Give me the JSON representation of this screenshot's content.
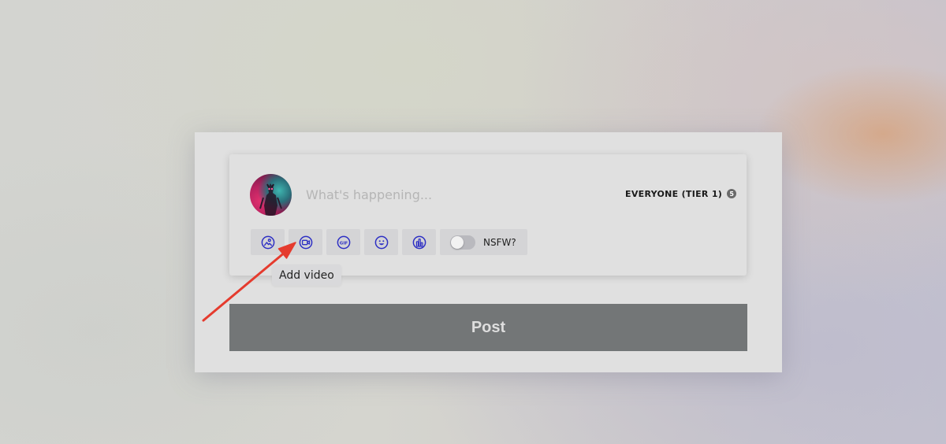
{
  "composer": {
    "placeholder": "What's happening...",
    "audience_label": "EVERYONE (TIER 1)",
    "audience_badge": "5"
  },
  "toolbar": {
    "tools": [
      {
        "name": "add-image",
        "icon": "image-icon"
      },
      {
        "name": "add-video",
        "icon": "video-icon"
      },
      {
        "name": "add-gif",
        "icon": "gif-icon",
        "icon_text": "GIF"
      },
      {
        "name": "add-emoji",
        "icon": "emoji-icon"
      },
      {
        "name": "add-poll",
        "icon": "poll-icon"
      }
    ],
    "nsfw_label": "NSFW?",
    "nsfw_on": false
  },
  "tooltip": {
    "text": "Add video"
  },
  "post_button": {
    "label": "Post"
  },
  "colors": {
    "icon_accent": "#2d2fc4",
    "post_button_bg": "#737677",
    "annotation_arrow": "#e53b2e"
  }
}
